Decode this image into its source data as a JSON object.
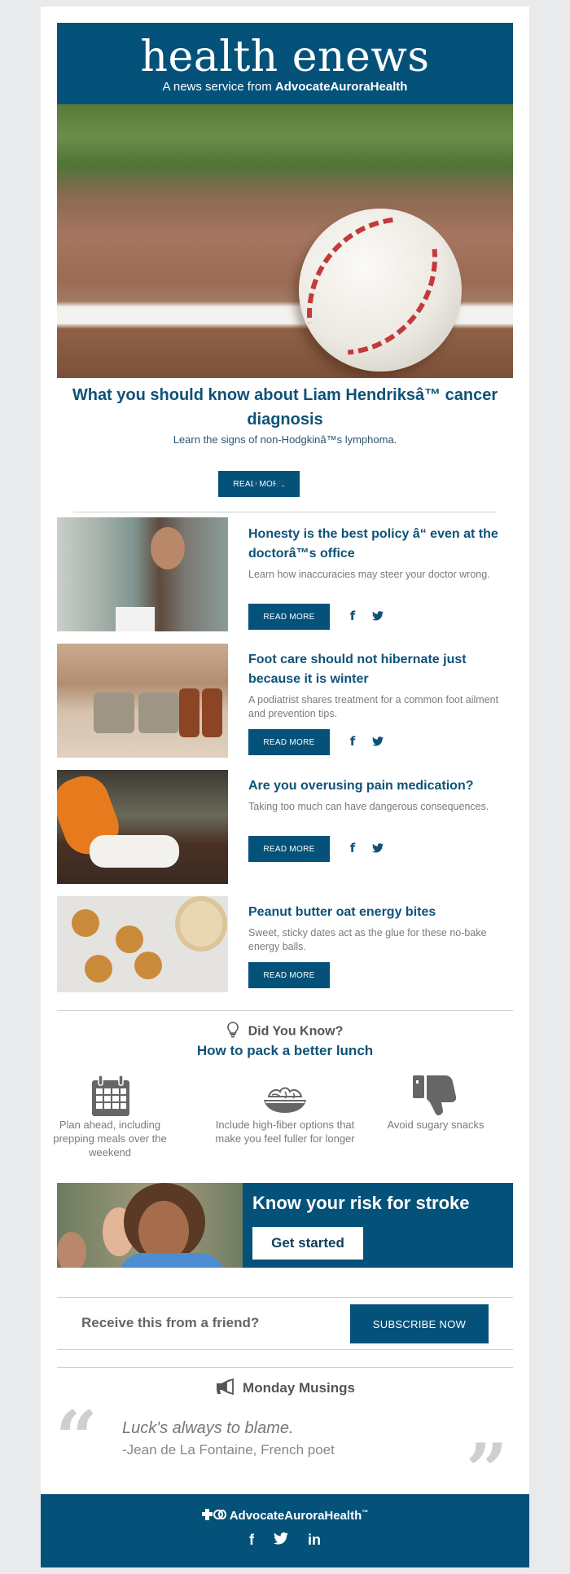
{
  "header": {
    "brand": "health enews",
    "tagline_prefix": "A news service from",
    "tagline_org": "AdvocateAuroraHealth"
  },
  "hero": {
    "image_alt": "baseball-on-field",
    "title": "What you should know about Liam Hendriksâ™ cancer diagnosis",
    "subtitle": "Learn the signs of non-Hodgkinâ™s lymphoma.",
    "read_more": "READ MORE"
  },
  "social": {
    "facebook": "f",
    "twitter": "🐦",
    "linkedin": "in"
  },
  "articles": [
    {
      "image_alt": "woman-with-clipboard",
      "title": "Honesty is the best policy â“ even at the doctorâ™s office",
      "description": "Learn how inaccuracies may steer your doctor wrong.",
      "read_more": "READ MORE",
      "has_social": true
    },
    {
      "image_alt": "person-lacing-boots",
      "title": "Foot care should not hibernate just because it is winter",
      "description": "A podiatrist shares treatment for a common foot ailment and prevention tips.",
      "read_more": "READ MORE",
      "has_social": true
    },
    {
      "image_alt": "spilled-pill-bottle",
      "title": "Are you overusing pain medication?",
      "description": "Taking too much can have dangerous consequences.",
      "read_more": "READ MORE",
      "has_social": true
    },
    {
      "image_alt": "energy-bites-with-chia",
      "title": "Peanut butter oat energy bites",
      "description": "Sweet, sticky dates act as the glue for these no-bake energy balls.",
      "read_more": "READ MORE",
      "has_social": false
    }
  ],
  "did_you_know": {
    "heading": "Did You Know?",
    "subheading": "How to pack a better lunch",
    "tips": [
      {
        "icon": "calendar-icon",
        "text": "Plan ahead, including prepping meals over the weekend"
      },
      {
        "icon": "salad-bowl-icon",
        "text": "Include high-fiber options that make you feel fuller for longer"
      },
      {
        "icon": "thumbs-down-icon",
        "text": "Avoid sugary snacks"
      }
    ]
  },
  "stroke_banner": {
    "title": "Know your risk for stroke",
    "button": "Get started"
  },
  "subscribe": {
    "prompt": "Receive this from a friend?",
    "button": "SUBSCRIBE NOW"
  },
  "musings": {
    "heading": "Monday Musings",
    "quote": "Luck's always to blame.",
    "attribution": "-Jean de La Fontaine, French poet"
  },
  "footer": {
    "org": "AdvocateAuroraHealth",
    "tm": "™"
  },
  "colors": {
    "brand_blue": "#04527a",
    "title_blue": "#0e5278",
    "text_gray": "#7a7a7a",
    "page_bg": "#e9eaeb"
  }
}
